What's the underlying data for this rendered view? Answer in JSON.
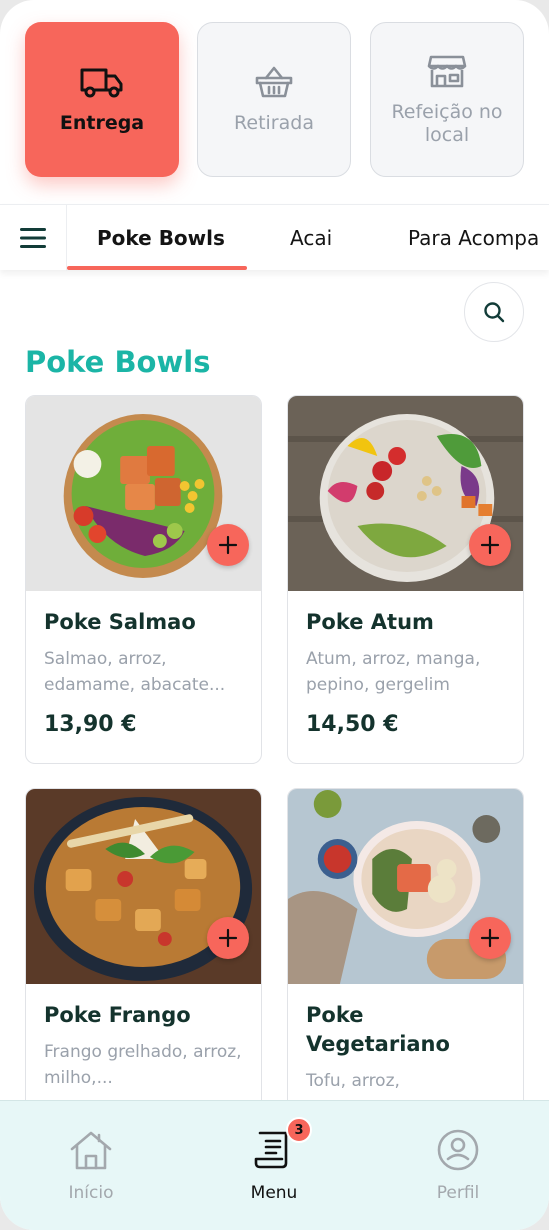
{
  "service_modes": [
    {
      "label": "Entrega",
      "icon": "truck-icon",
      "active": true
    },
    {
      "label": "Retirada",
      "icon": "basket-icon",
      "active": false
    },
    {
      "label": "Refeição no local",
      "icon": "storefront-icon",
      "active": false
    }
  ],
  "tabs": [
    "Poke Bowls",
    "Acai",
    "Para Acompa"
  ],
  "section_title": "Poke Bowls",
  "products": [
    {
      "name": "Poke Salmao",
      "description": "Salmao, arroz, edamame, abacate...",
      "price": "13,90 €"
    },
    {
      "name": "Poke Atum",
      "description": "Atum, arroz, manga, pepino, gergelim",
      "price": "14,50 €"
    },
    {
      "name": "Poke Frango",
      "description": "Frango grelhado, arroz, milho,...",
      "price": ""
    },
    {
      "name": "Poke Vegetariano",
      "description": "Tofu, arroz,",
      "price": ""
    }
  ],
  "bottom_nav": [
    {
      "label": "Início",
      "icon": "home-icon"
    },
    {
      "label": "Menu",
      "icon": "menu-receipt-icon",
      "badge": "3"
    },
    {
      "label": "Perfil",
      "icon": "profile-icon"
    }
  ],
  "colors": {
    "accent": "#f7665b",
    "title": "#1bb5a6",
    "text_dark": "#14332d",
    "muted": "#9aa1ab",
    "nav_bg": "#e7f7f7"
  }
}
